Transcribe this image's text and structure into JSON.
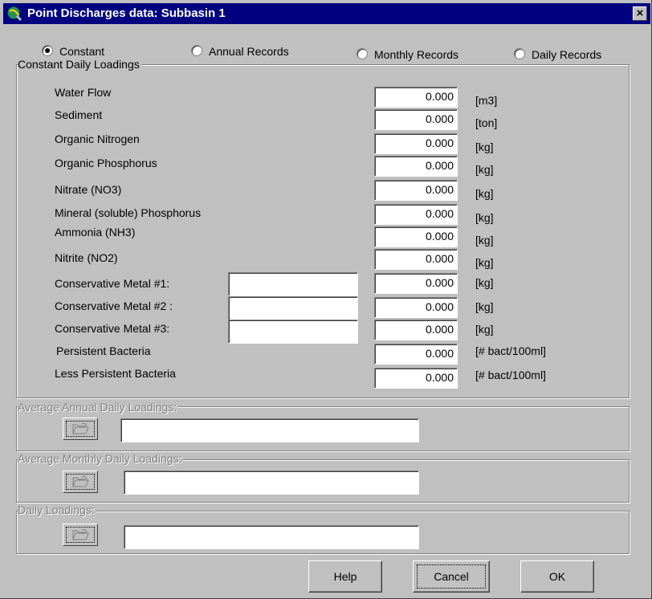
{
  "window": {
    "title": "Point Discharges data: Subbasin 1",
    "close_label": "×"
  },
  "radios": [
    {
      "label": "Constant",
      "checked": true
    },
    {
      "label": "Annual Records",
      "checked": false
    },
    {
      "label": "Monthly Records",
      "checked": false
    },
    {
      "label": "Daily Records",
      "checked": false
    }
  ],
  "constant_group": {
    "title": "Constant Daily Loadings",
    "rows": [
      {
        "label": "Water Flow",
        "value": "0.000",
        "unit": "[m3]"
      },
      {
        "label": "Sediment",
        "value": "0.000",
        "unit": "[ton]"
      },
      {
        "label": "Organic Nitrogen",
        "value": "0.000",
        "unit": "[kg]"
      },
      {
        "label": "Organic Phosphorus",
        "value": "0.000",
        "unit": "[kg]"
      },
      {
        "label": "Nitrate (NO3)",
        "value": "0.000",
        "unit": "[kg]"
      },
      {
        "label": "Mineral (soluble) Phosphorus",
        "value": "0.000",
        "unit": "[kg]"
      },
      {
        "label": "Ammonia (NH3)",
        "value": "0.000",
        "unit": "[kg]"
      },
      {
        "label": "Nitrite (NO2)",
        "value": "0.000",
        "unit": "[kg]"
      },
      {
        "label": "Conservative Metal #1:",
        "value": "0.000",
        "unit": "[kg]",
        "name": ""
      },
      {
        "label": "Conservative Metal #2 :",
        "value": "0.000",
        "unit": "[kg]",
        "name": ""
      },
      {
        "label": "Conservative Metal #3:",
        "value": "0.000",
        "unit": "[kg]",
        "name": ""
      },
      {
        "label": "Persistent Bacteria",
        "value": "0.000",
        "unit": "[# bact/100ml]"
      },
      {
        "label": "Less Persistent Bacteria",
        "value": "0.000",
        "unit": "[# bact/100ml]"
      }
    ]
  },
  "annual_group": {
    "title": "Average Annual  Daily Loadings:",
    "file_value": "",
    "icon": "open-file-icon"
  },
  "monthly_group": {
    "title": "Average Monthly Daily Loadings:",
    "file_value": "",
    "icon": "open-file-icon"
  },
  "daily_group": {
    "title": "Daily Loadings:",
    "file_value": "",
    "icon": "open-file-icon"
  },
  "buttons": {
    "help": "Help",
    "cancel": "Cancel",
    "ok": "OK"
  },
  "colors": {
    "titlebar": "#000080",
    "face": "#c0c0c0",
    "disabled_text": "#808080"
  }
}
